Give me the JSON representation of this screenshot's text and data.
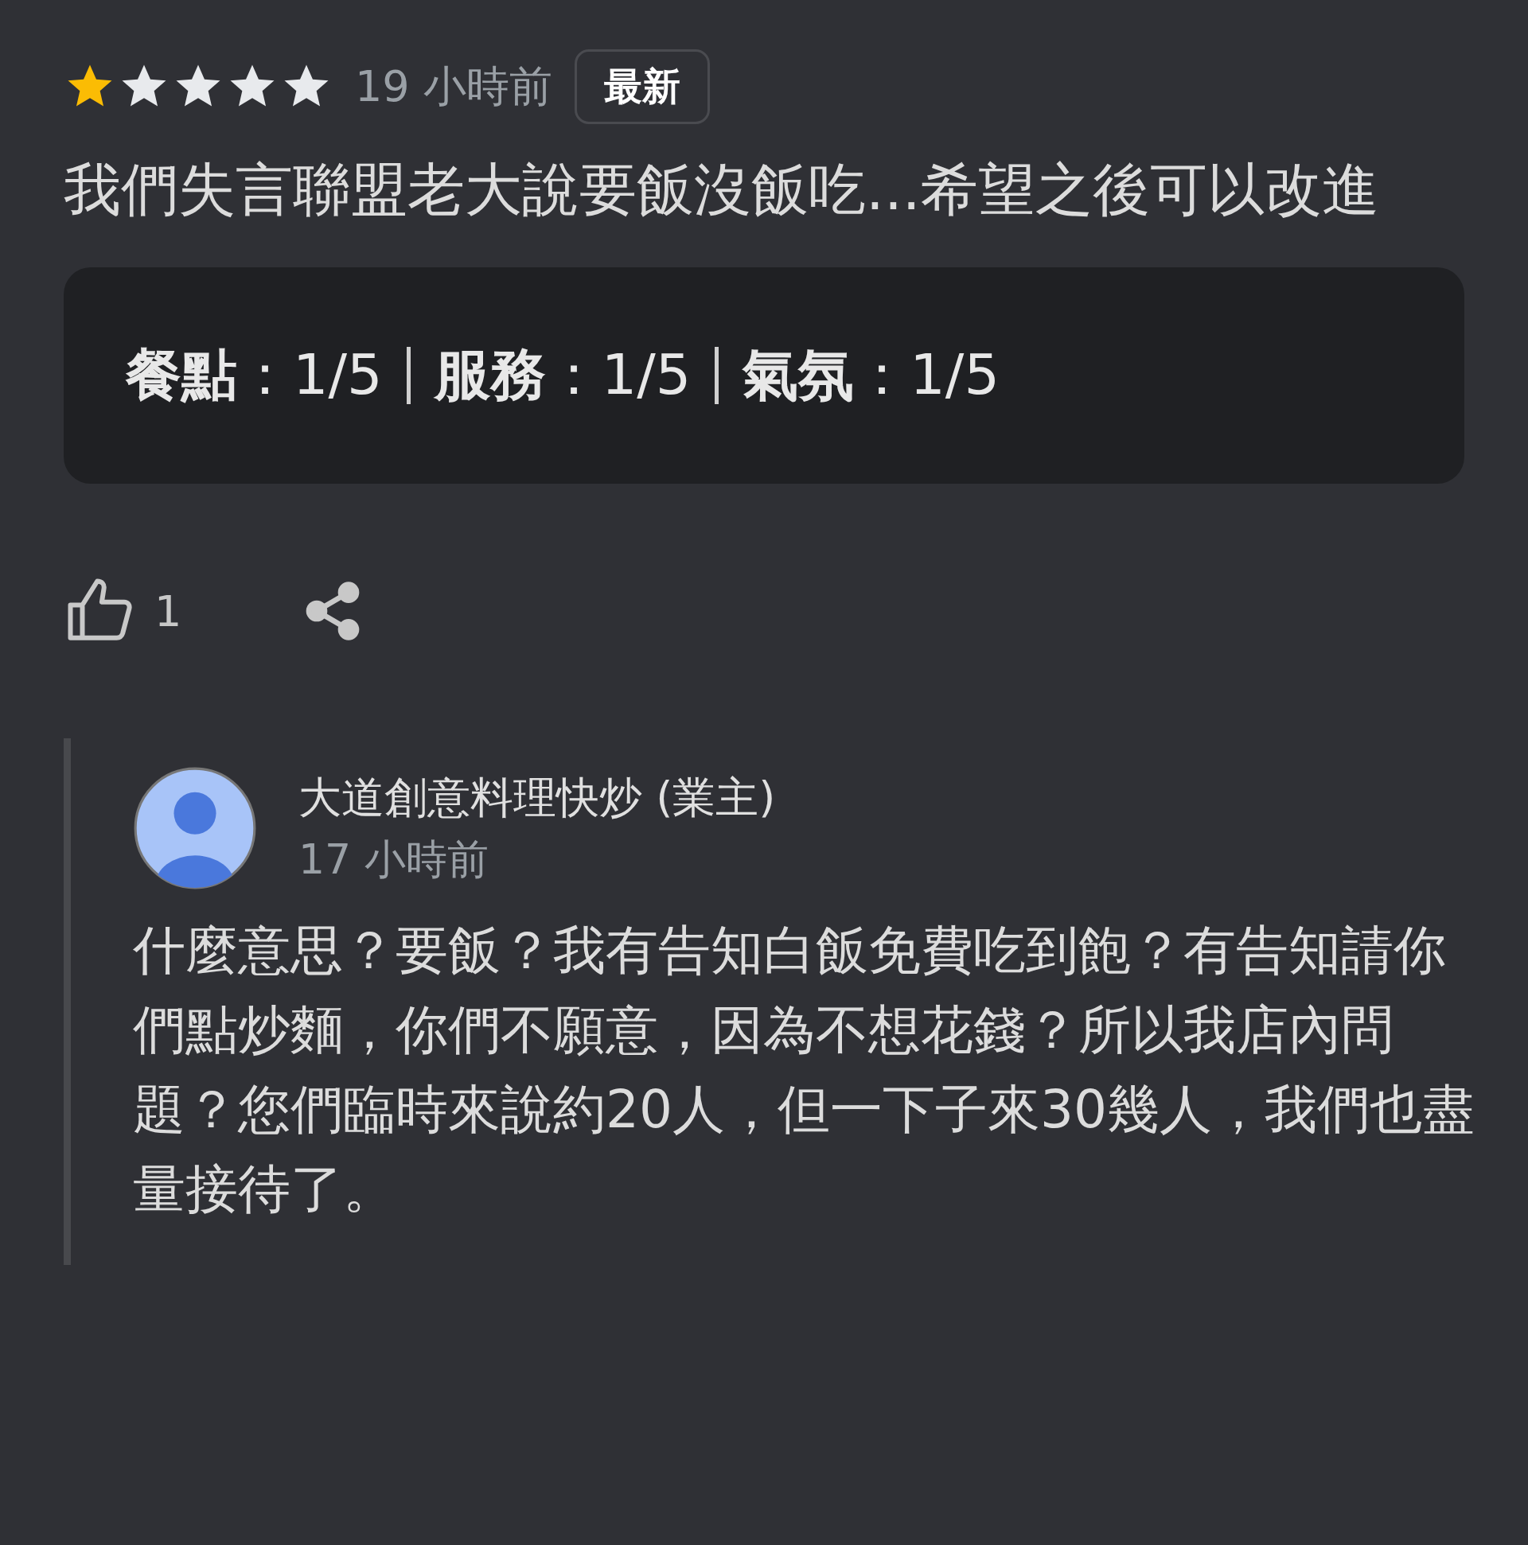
{
  "review": {
    "stars": 1,
    "time": "19 小時前",
    "badge": "最新",
    "text": "我們失言聯盟老大說要飯沒飯吃...希望之後可以改進",
    "ratings": [
      {
        "text": "**餐點**：1/5"
      },
      {
        "text": "**服務**：1/5"
      },
      {
        "text": "**氣氛**：1/5"
      }
    ],
    "likes": "1"
  },
  "reply": {
    "author": "大道創意料理快炒 (業主)",
    "time": "17 小時前",
    "text": "什麼意思？要飯？我有告知白飯免費吃到飽？有告知請你們點炒麵，你們不願意，因為不想花錢？所以我店內問題？您們臨時來說約20人，但一下子來30幾人，我們也盡量接待了。"
  }
}
